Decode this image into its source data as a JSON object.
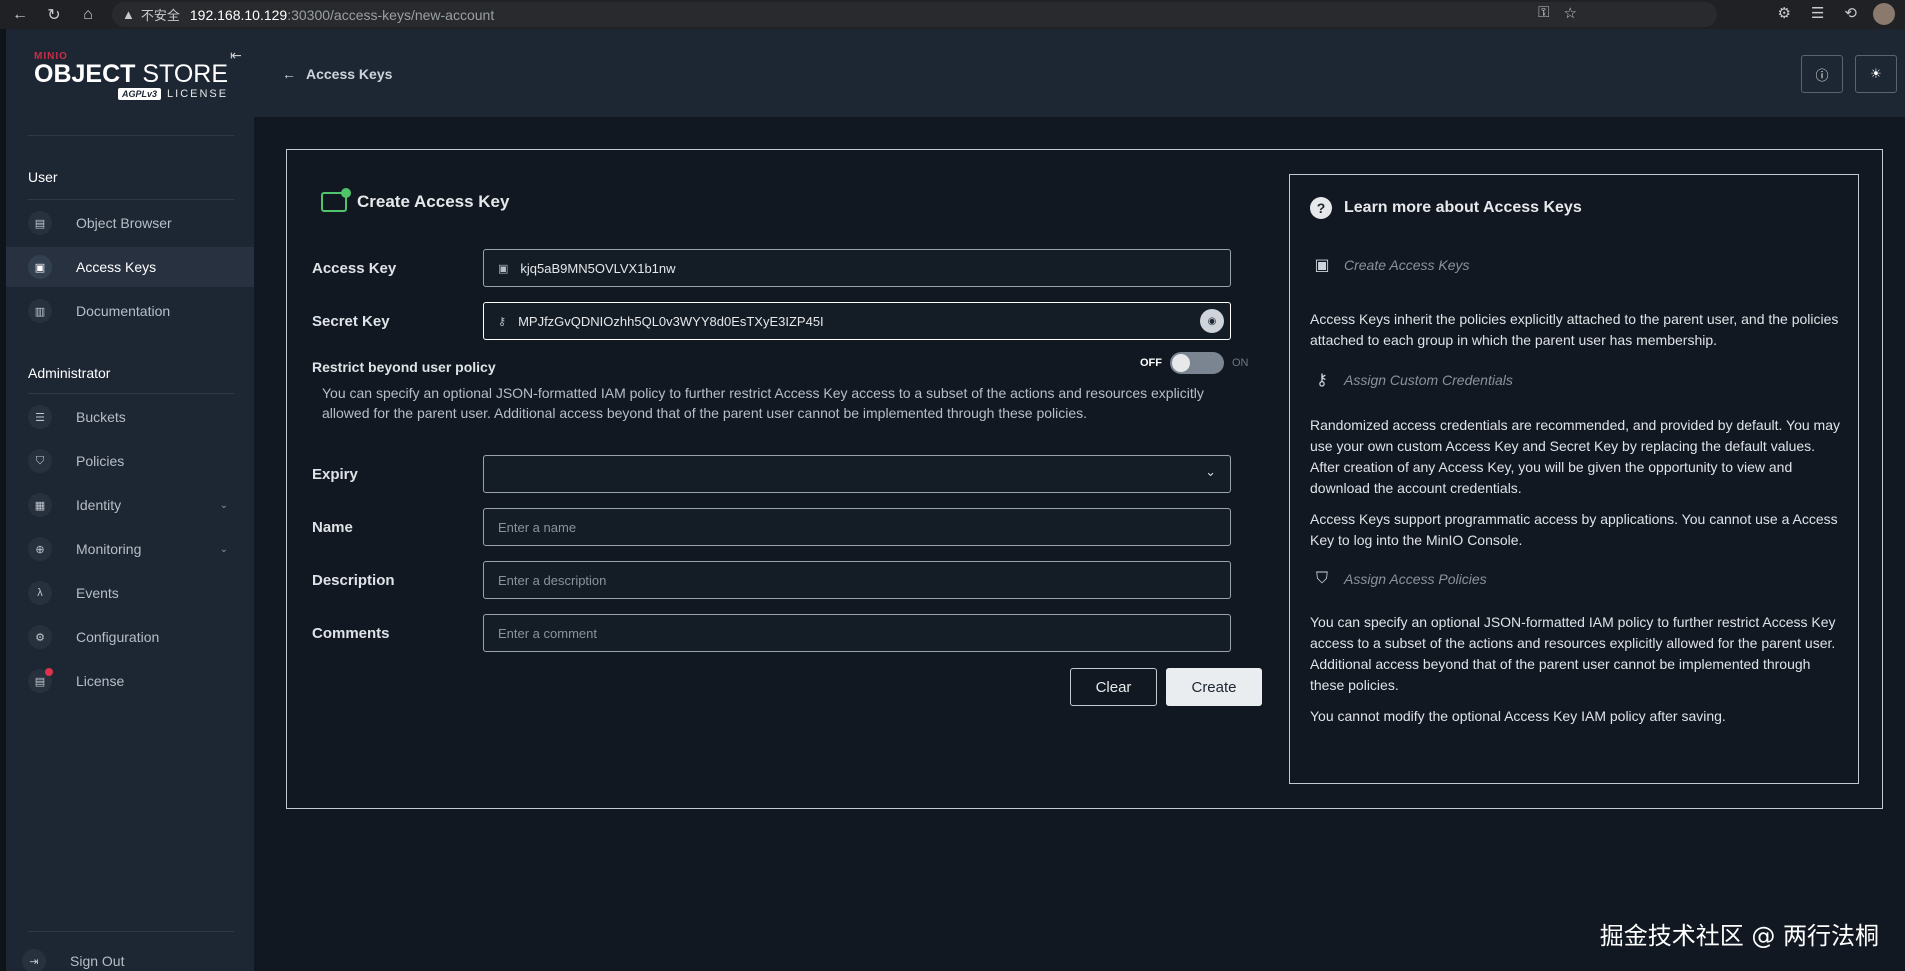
{
  "browser": {
    "security_label": "不安全",
    "url_host": "192.168.10.129",
    "url_path": ":30300/access-keys/new-account"
  },
  "logo": {
    "minio": "MINIO",
    "brand_bold": "OBJECT",
    "brand_rest": " STORE",
    "agpl": "AGPLv3",
    "license": "LICENSE"
  },
  "sidebar": {
    "user_section": "User",
    "admin_section": "Administrator",
    "user_items": [
      {
        "label": "Object Browser",
        "icon": "object-browser-icon"
      },
      {
        "label": "Access Keys",
        "icon": "access-keys-icon"
      },
      {
        "label": "Documentation",
        "icon": "documentation-icon"
      }
    ],
    "admin_items": [
      {
        "label": "Buckets",
        "icon": "buckets-icon"
      },
      {
        "label": "Policies",
        "icon": "policies-icon"
      },
      {
        "label": "Identity",
        "icon": "identity-icon"
      },
      {
        "label": "Monitoring",
        "icon": "monitoring-icon"
      },
      {
        "label": "Events",
        "icon": "events-icon"
      },
      {
        "label": "Configuration",
        "icon": "configuration-icon"
      },
      {
        "label": "License",
        "icon": "license-icon"
      }
    ],
    "sign_out": "Sign Out"
  },
  "header": {
    "back_label": "Access Keys"
  },
  "form": {
    "title": "Create Access Key",
    "access_key_label": "Access Key",
    "access_key_value": "kjq5aB9MN5OVLVX1b1nw",
    "secret_key_label": "Secret Key",
    "secret_key_value": "MPJfzGvQDNIOzhh5QL0v3WYY8d0EsTXyE3IZP45I",
    "restrict_label": "Restrict beyond user policy",
    "toggle_off": "OFF",
    "toggle_on": "ON",
    "restrict_desc": "You can specify an optional JSON-formatted IAM policy to further restrict Access Key access to a subset of the actions and resources explicitly allowed for the parent user. Additional access beyond that of the parent user cannot be implemented through these policies.",
    "expiry_label": "Expiry",
    "expiry_value": "",
    "name_label": "Name",
    "name_placeholder": "Enter a name",
    "description_label": "Description",
    "description_placeholder": "Enter a description",
    "comments_label": "Comments",
    "comments_placeholder": "Enter a comment",
    "clear_label": "Clear",
    "create_label": "Create"
  },
  "help": {
    "title": "Learn more about Access Keys",
    "section1_title": "Create Access Keys",
    "section1_text": "Access Keys inherit the policies explicitly attached to the parent user, and the policies attached to each group in which the parent user has membership.",
    "section2_title": "Assign Custom Credentials",
    "section2_text": "Randomized access credentials are recommended, and provided by default. You may use your own custom Access Key and Secret Key by replacing the default values. After creation of any Access Key, you will be given the opportunity to view and download the account credentials.",
    "section2_text2": "Access Keys support programmatic access by applications. You cannot use a Access Key to log into the MinIO Console.",
    "section3_title": "Assign Access Policies",
    "section3_text": "You can specify an optional JSON-formatted IAM policy to further restrict Access Key access to a subset of the actions and resources explicitly allowed for the parent user. Additional access beyond that of the parent user cannot be implemented through these policies.",
    "section3_text2": "You cannot modify the optional Access Key IAM policy after saving."
  },
  "watermark": "掘金技术社区 @ 两行法桐",
  "colors": {
    "background": "#111822",
    "sidebar": "#1d2633",
    "accent_green": "#4fc46a",
    "license_dot": "#e0324a"
  }
}
